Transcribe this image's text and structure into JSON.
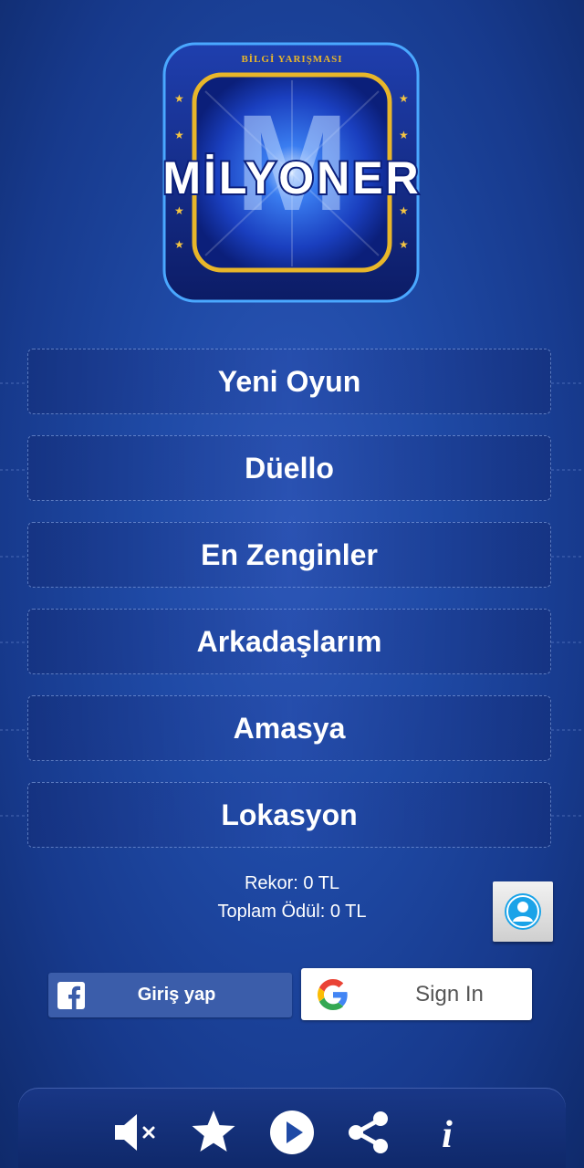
{
  "logo": {
    "subtitle": "BİLGİ YARIŞMASI",
    "title": "MİLYONER",
    "letter": "M"
  },
  "menu": [
    {
      "label": "Yeni Oyun"
    },
    {
      "label": "Düello"
    },
    {
      "label": "En Zenginler"
    },
    {
      "label": "Arkadaşlarım"
    },
    {
      "label": "Amasya"
    },
    {
      "label": "Lokasyon"
    }
  ],
  "stats": {
    "record": "Rekor: 0 TL",
    "total_prize": "Toplam Ödül: 0 TL"
  },
  "auth": {
    "facebook_label": "Giriş yap",
    "google_label": "Sign In"
  },
  "bottom_bar": {
    "icons": [
      "mute-icon",
      "star-icon",
      "play-icon",
      "share-icon",
      "info-icon"
    ]
  },
  "colors": {
    "background": "#1f4aa6",
    "facebook": "#3b5daa",
    "accent_gold": "#e8b62a",
    "profile_icon": "#1aa3e8"
  }
}
